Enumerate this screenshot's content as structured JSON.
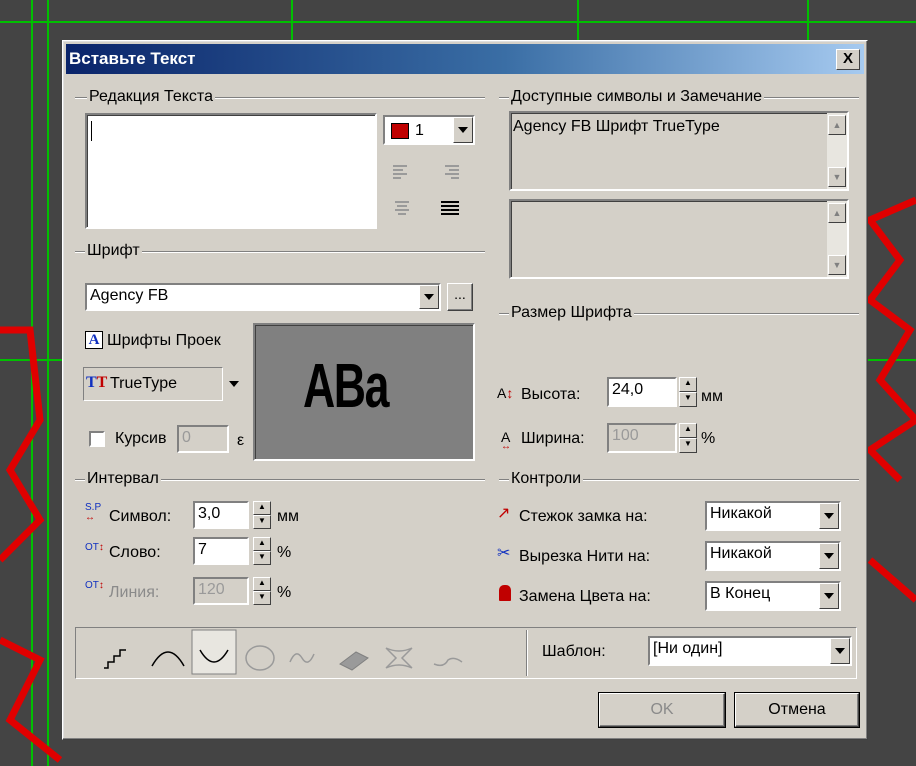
{
  "dialog": {
    "title": "Вставьте Текст",
    "close_label": "X"
  },
  "text_edit": {
    "group_label": "Редакция Текста",
    "value": "",
    "color_value": "1",
    "color_swatch": "#c00000"
  },
  "available": {
    "group_label": "Доступные символы и Замечание",
    "info_text": "Agency FB Шрифт TrueType",
    "note_text": ""
  },
  "font": {
    "group_label": "Шрифт",
    "selected": "Agency FB",
    "more_label": "...",
    "project_fonts_label": "Шрифты Проек",
    "type_label": "TrueType",
    "italic_label": "Курсив",
    "italic_value": "0",
    "italic_unit": "ε",
    "preview_text": "ABa"
  },
  "font_size": {
    "group_label": "Размер Шрифта",
    "height_label": "Высота:",
    "height_value": "24,0",
    "height_unit": "мм",
    "width_label": "Ширина:",
    "width_value": "100",
    "width_unit": "%"
  },
  "interval": {
    "group_label": "Интервал",
    "char_label": "Символ:",
    "char_value": "3,0",
    "char_unit": "мм",
    "word_label": "Слово:",
    "word_value": "7",
    "word_unit": "%",
    "line_label": "Линия:",
    "line_value": "120",
    "line_unit": "%"
  },
  "controls": {
    "group_label": "Контроли",
    "lock_label": "Стежок замка на:",
    "lock_value": "Никакой",
    "cut_label": "Вырезка Нити на:",
    "cut_value": "Никакой",
    "color_change_label": "Замена Цвета на:",
    "color_change_value": "В Конец"
  },
  "template": {
    "label": "Шаблон:",
    "value": "[Ни один]"
  },
  "buttons": {
    "ok": "OK",
    "cancel": "Отмена"
  },
  "colors": {
    "dialog_bg": "#d4d0c8",
    "title_start": "#0a246a",
    "title_end": "#a6caf0",
    "canvas_bg": "#444444",
    "grid_green": "#00c000",
    "stitch_red": "#e00000"
  }
}
